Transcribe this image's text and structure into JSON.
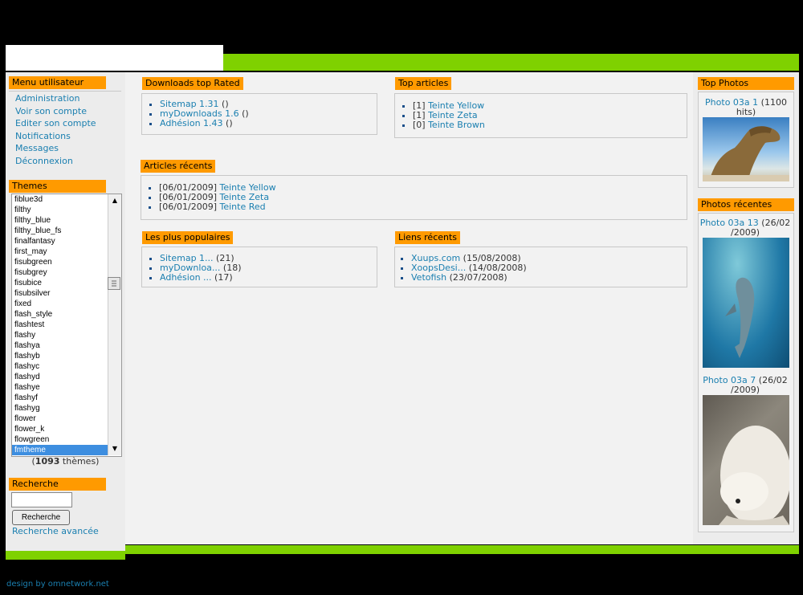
{
  "footer": "design by omnetwork.net",
  "user_menu": {
    "title": "Menu utilisateur",
    "items": [
      "Administration",
      "Voir son compte",
      "Editer son compte",
      "Notifications",
      "Messages",
      "Déconnexion"
    ]
  },
  "themes": {
    "title": "Themes",
    "options": [
      "fiblue3d",
      "filthy",
      "filthy_blue",
      "filthy_blue_fs",
      "finalfantasy",
      "first_may",
      "fisubgreen",
      "fisubgrey",
      "fisubice",
      "fisubsilver",
      "fixed",
      "flash_style",
      "flashtest",
      "flashy",
      "flashya",
      "flashyb",
      "flashyc",
      "flashyd",
      "flashye",
      "flashyf",
      "flashyg",
      "flower",
      "flower_k",
      "flowgreen",
      "fmtheme"
    ],
    "selected": "fmtheme",
    "count_open": "(",
    "count": "1093",
    "count_close": " thèmes)"
  },
  "search": {
    "title": "Recherche",
    "input_value": "",
    "button_label": "Recherche",
    "advanced_link": "Recherche avancée"
  },
  "downloads": {
    "title": "Downloads top Rated",
    "items": [
      {
        "link": "Sitemap 1.31",
        "suffix": " ()"
      },
      {
        "link": "myDownloads 1.6",
        "suffix": " ()"
      },
      {
        "link": "Adhésion 1.43",
        "suffix": " ()"
      }
    ]
  },
  "top_articles": {
    "title": "Top articles",
    "items": [
      {
        "prefix": "[1] ",
        "link": "Teinte Yellow"
      },
      {
        "prefix": "[1] ",
        "link": "Teinte Zeta"
      },
      {
        "prefix": "[0] ",
        "link": "Teinte Brown"
      }
    ]
  },
  "recent_articles": {
    "title": "Articles récents",
    "items": [
      {
        "prefix": "[06/01/2009] ",
        "link": "Teinte Yellow"
      },
      {
        "prefix": "[06/01/2009] ",
        "link": "Teinte Zeta"
      },
      {
        "prefix": "[06/01/2009] ",
        "link": "Teinte Red"
      }
    ]
  },
  "popular": {
    "title": "Les plus populaires",
    "items": [
      {
        "link": "Sitemap 1...",
        "suffix": " (21)"
      },
      {
        "link": "myDownloa...",
        "suffix": " (18)"
      },
      {
        "link": "Adhésion ...",
        "suffix": " (17)"
      }
    ]
  },
  "recent_links": {
    "title": "Liens récents",
    "items": [
      {
        "link": "Xuups.com",
        "suffix": " (15/08/2008)"
      },
      {
        "link": "XoopsDesi...",
        "suffix": " (14/08/2008)"
      },
      {
        "link": "Vetofish",
        "suffix": " (23/07/2008)"
      }
    ]
  },
  "top_photos": {
    "title": "Top Photos",
    "photo": {
      "link": "Photo 03a 1",
      "suffix_a": " (1100",
      "suffix_b": "hits)"
    }
  },
  "recent_photos": {
    "title": "Photos récentes",
    "photos": [
      {
        "link": "Photo 03a 13",
        "suffix_a": " (26/02",
        "suffix_b": "/2009)"
      },
      {
        "link": "Photo 03a 7",
        "suffix_a": " (26/02",
        "suffix_b": "/2009)"
      }
    ]
  },
  "colors": {
    "accent_green": "#7fd100",
    "block_title_orange": "#ff9a00",
    "link_blue": "#1a7fb0"
  }
}
